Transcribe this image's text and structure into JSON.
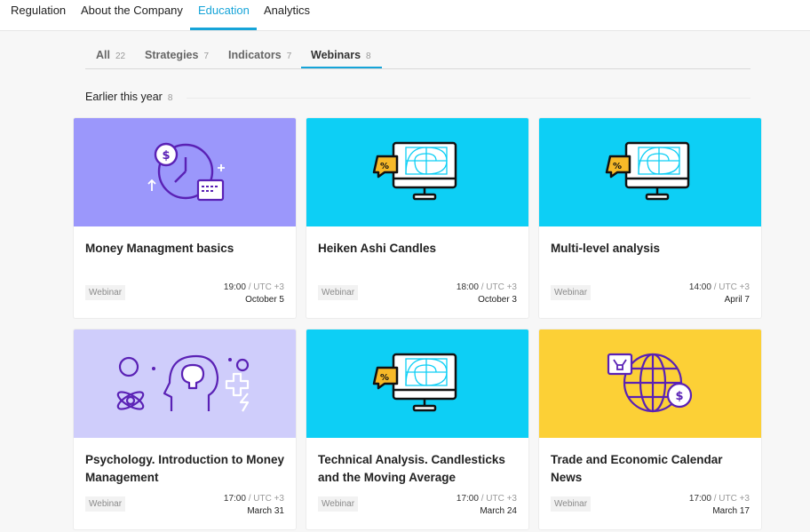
{
  "nav": {
    "items": [
      {
        "label": "Regulation"
      },
      {
        "label": "About the Company"
      },
      {
        "label": "Education"
      },
      {
        "label": "Analytics"
      }
    ]
  },
  "tabs": [
    {
      "label": "All",
      "count": "22"
    },
    {
      "label": "Strategies",
      "count": "7"
    },
    {
      "label": "Indicators",
      "count": "7"
    },
    {
      "label": "Webinars",
      "count": "8"
    }
  ],
  "section": {
    "title": "Earlier this year",
    "count": "8"
  },
  "cards": [
    {
      "title": "Money Managment basics",
      "tag": "Webinar",
      "time": "19:00",
      "tz": "/ UTC +3",
      "date": "October 5",
      "bg": "#9b97fb",
      "icon": "clock-money-icon"
    },
    {
      "title": "Heiken Ashi Candles",
      "tag": "Webinar",
      "time": "18:00",
      "tz": "/ UTC +3",
      "date": "October 3",
      "bg": "#0dcff5",
      "icon": "monitor-chart-icon"
    },
    {
      "title": "Multi-level analysis",
      "tag": "Webinar",
      "time": "14:00",
      "tz": "/ UTC +3",
      "date": "April 7",
      "bg": "#0dcff5",
      "icon": "monitor-chart-icon"
    },
    {
      "title": "Psychology. Introduction to Money Management",
      "tag": "Webinar",
      "time": "17:00",
      "tz": "/ UTC +3",
      "date": "March 31",
      "bg": "#cfcdfb",
      "icon": "head-brain-icon"
    },
    {
      "title": "Technical Analysis. Candlesticks and the Moving Average",
      "tag": "Webinar",
      "time": "17:00",
      "tz": "/ UTC +3",
      "date": "March 24",
      "bg": "#0dcff5",
      "icon": "monitor-chart-icon"
    },
    {
      "title": "Trade and Economic Calendar News",
      "tag": "Webinar",
      "time": "17:00",
      "tz": "/ UTC +3",
      "date": "March 17",
      "bg": "#fcd036",
      "icon": "globe-bull-icon"
    }
  ],
  "colors": {
    "accent": "#16a4d8",
    "icon_stroke": "#5a21b5",
    "bubble": "#f7b928"
  }
}
